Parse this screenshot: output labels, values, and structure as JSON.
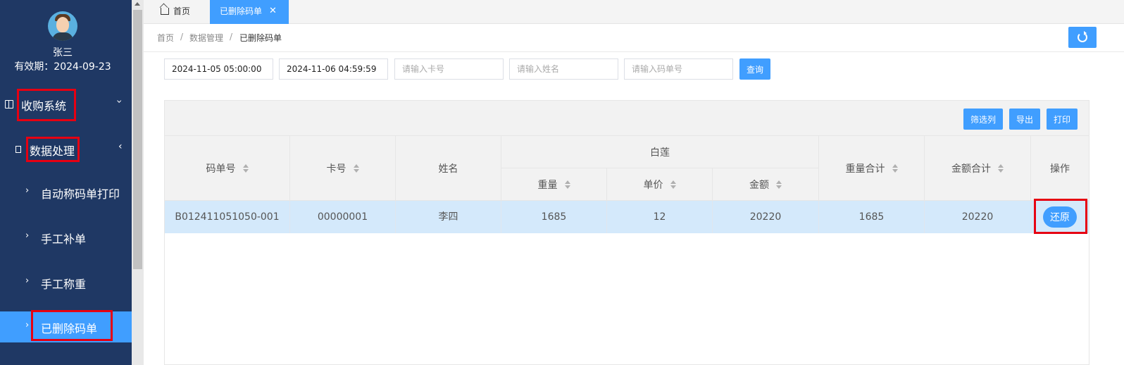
{
  "user": {
    "name": "张三",
    "valid_until": "有效期：2024-09-23"
  },
  "sidebar": {
    "top_menu": "收购系统",
    "sub_menu": "数据处理",
    "items": [
      {
        "label": "自动称码单打印"
      },
      {
        "label": "手工补单"
      },
      {
        "label": "手工称重"
      },
      {
        "label": "已删除码单"
      }
    ]
  },
  "tabs": {
    "home": "首页",
    "active": "已删除码单"
  },
  "breadcrumb": {
    "home": "首页",
    "section": "数据管理",
    "current": "已删除码单",
    "sep": "/"
  },
  "filters": {
    "start": "2024-11-05 05:00:00",
    "end": "2024-11-06 04:59:59",
    "card_placeholder": "请输入卡号",
    "name_placeholder": "请输入姓名",
    "order_placeholder": "请输入码单号",
    "query_label": "查询"
  },
  "toolbar": {
    "columns_label": "筛选列",
    "export_label": "导出",
    "print_label": "打印"
  },
  "table": {
    "headers": {
      "order_no": "码单号",
      "card_no": "卡号",
      "name": "姓名",
      "group": "白莲",
      "weight": "重量",
      "price": "单价",
      "amount": "金额",
      "total_weight": "重量合计",
      "total_amount": "金额合计",
      "action": "操作"
    },
    "rows": [
      {
        "order_no": "B012411051050-001",
        "card_no": "00000001",
        "name": "李四",
        "weight": "1685",
        "price": "12",
        "amount": "20220",
        "total_weight": "1685",
        "total_amount": "20220",
        "action_label": "还原"
      }
    ]
  },
  "colors": {
    "sidebar_bg": "#1f3864",
    "accent": "#409eff",
    "highlight": "#e60012",
    "row_selected": "#d4e9fb"
  }
}
